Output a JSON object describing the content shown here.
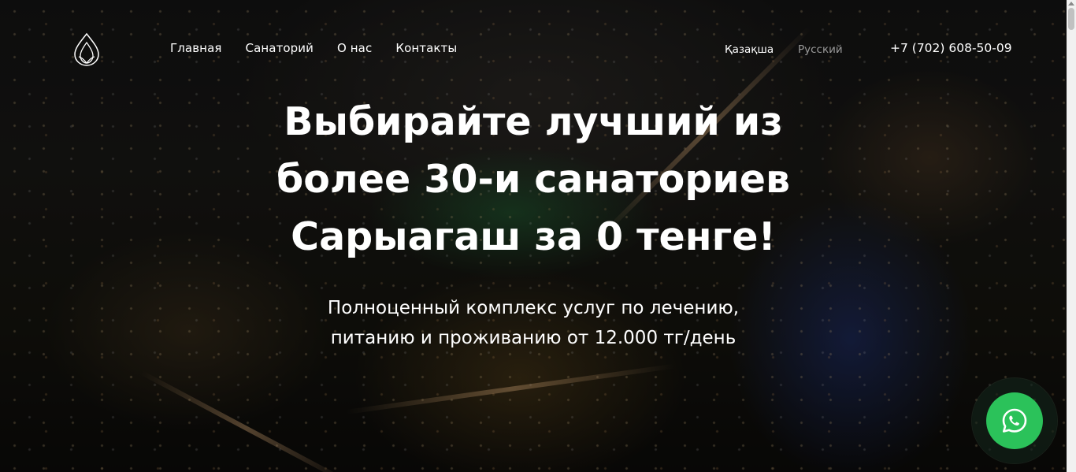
{
  "header": {
    "logo_icon": "lotus-drop-logo",
    "nav": [
      {
        "label": "Главная"
      },
      {
        "label": "Санаторий"
      },
      {
        "label": "О нас"
      },
      {
        "label": "Контакты"
      }
    ],
    "languages": {
      "kazakh": "Қазақша",
      "russian": "Русский",
      "active": "kazakh"
    },
    "phone": "+7 (702) 608-50-09"
  },
  "hero": {
    "headline_lines": [
      "Выбирайте лучший из",
      "более 30-и санаториев",
      "Сарыагаш за 0 тенге!"
    ],
    "subline_lines": [
      "Полноценный комплекс услуг по лечению,",
      "питанию и проживанию от 12.000 тг/день"
    ],
    "background": "night-city-aerial-photo"
  },
  "whatsapp": {
    "icon": "whatsapp-icon",
    "color": "#2bc25a"
  },
  "colors": {
    "text": "#ffffff",
    "inactive_lang": "#9b9b9b"
  }
}
